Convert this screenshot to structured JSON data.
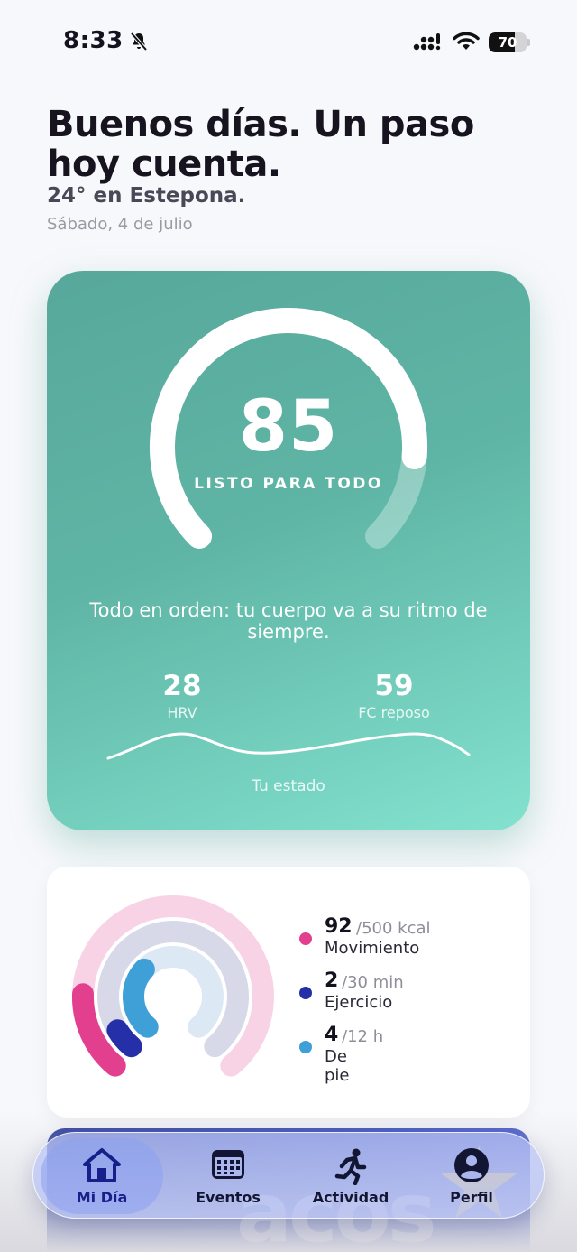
{
  "status_bar": {
    "time": "8:33",
    "battery": "70",
    "battery_level": 0.7
  },
  "header": {
    "greeting": "Buenos días. Un paso hoy cuenta.",
    "weather": "24° en Estepona.",
    "date": "Sábado, 4 de julio"
  },
  "readiness": {
    "score": "85",
    "label": "LISTO PARA TODO",
    "message": "Todo en orden: tu cuerpo va a su ritmo de siempre.",
    "hrv": {
      "value": "28",
      "label": "HRV"
    },
    "fc": {
      "value": "59",
      "label": "FC reposo"
    },
    "trend_label": "Tu estado",
    "colors": {
      "card_start": "#57a89b",
      "card_end": "#83e2cf"
    }
  },
  "activity": {
    "items": [
      {
        "value": "92",
        "goal": "/500 kcal",
        "name": "Movimiento",
        "color": "#e2408f",
        "fraction": 0.184
      },
      {
        "value": "2",
        "goal": "/30 min",
        "name": "Ejercicio",
        "color": "#2530a8",
        "fraction": 0.067
      },
      {
        "value": "4",
        "goal": "/12 h",
        "name": "De pie",
        "color": "#3fa0d8",
        "fraction": 0.333
      }
    ]
  },
  "tabs": [
    {
      "label": "Mi Día",
      "icon": "home-icon",
      "active": true
    },
    {
      "label": "Eventos",
      "icon": "calendar-icon",
      "active": false
    },
    {
      "label": "Actividad",
      "icon": "running-icon",
      "active": false
    },
    {
      "label": "Perfil",
      "icon": "profile-icon",
      "active": false
    }
  ],
  "promo": {
    "text": "acos"
  }
}
